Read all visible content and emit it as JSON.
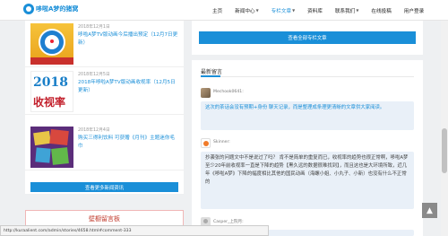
{
  "header": {
    "logo_text": "哆啦A梦的猪窝",
    "nav": [
      {
        "label": "主页",
        "has_caret": false,
        "active": false
      },
      {
        "label": "新闻中心",
        "has_caret": true,
        "active": false
      },
      {
        "label": "专栏文章",
        "has_caret": true,
        "active": true
      },
      {
        "label": "资料库",
        "has_caret": false,
        "active": false
      },
      {
        "label": "联系我们",
        "has_caret": true,
        "active": false
      },
      {
        "label": "在线投稿",
        "has_caret": false,
        "active": false
      },
      {
        "label": "用户登录",
        "has_caret": false,
        "active": false
      }
    ]
  },
  "news": {
    "items": [
      {
        "date": "2018年12月1日",
        "title": "哆啦A梦TV版动画今后播出预定（12月7日更新）"
      },
      {
        "date": "2018年12月5日",
        "title": "2018年哆啦A梦TV版动画收视率（12月5日更新）"
      },
      {
        "date": "2018年12月4日",
        "title": "购买三得利饮料 可获赠《月刊》主题迷你毛巾"
      }
    ],
    "thumb2": {
      "number": "2018",
      "word": "收视率"
    },
    "more_label": "查看更多新闻资讯"
  },
  "board": {
    "title": "壁橱留言板"
  },
  "articles": {
    "more_label": "查看全部专栏文章"
  },
  "comments": {
    "title": "最新留言",
    "items": [
      {
        "name": "Mechook0641:",
        "text": "这次的茶话会没有预期+身份 聊天记录，而是整理成条理更清晰的文章供大家阅读。",
        "style": "blue"
      },
      {
        "name": "Skinner:",
        "text": "抄袭张的问题文中不是说过了吗？ 肯不是简单的重复而已，收视率的趋势也很正常啊，哆啦A梦至少20年前收视率一直是下降的趋势【黑久远的数据很难找到】，而且这也是大环境所致，近几年《哆啦A梦》下降的幅度相比其他的国民动画（海螺小姐、小丸子、小新）也没有什么不正常的",
        "style": "dark"
      },
      {
        "name": "Casper_上院月:",
        "text": "",
        "style": "dark"
      }
    ]
  },
  "status_bar": {
    "url": "http://kuraalient.com/admin/stories/4658.html#comment-333"
  },
  "back_to_top_icon": "▲"
}
